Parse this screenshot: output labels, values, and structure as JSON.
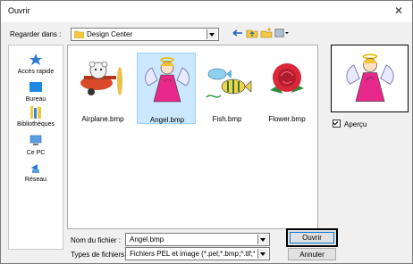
{
  "dialog": {
    "title": "Ouvrir",
    "close_glyph": "✕"
  },
  "lookin": {
    "label": "Regarder dans :",
    "value": "Design Center",
    "toolbar_icons": [
      "back-icon",
      "up-folder-icon",
      "new-folder-icon",
      "view-menu-icon"
    ]
  },
  "places": [
    {
      "label": "Accès rapide",
      "icon": "star-icon"
    },
    {
      "label": "Bureau",
      "icon": "desktop-icon"
    },
    {
      "label": "Bibliothèques",
      "icon": "libraries-icon"
    },
    {
      "label": "Ce PC",
      "icon": "computer-icon"
    },
    {
      "label": "Réseau",
      "icon": "network-icon"
    }
  ],
  "files": [
    {
      "name": "Airplane.bmp",
      "icon": "airplane-thumbnail",
      "selected": false
    },
    {
      "name": "Angel.bmp",
      "icon": "angel-thumbnail",
      "selected": true
    },
    {
      "name": "Fish.bmp",
      "icon": "fish-thumbnail",
      "selected": false
    },
    {
      "name": "Flower.bmp",
      "icon": "flower-thumbnail",
      "selected": false
    }
  ],
  "preview": {
    "checkbox_label": "Aperçu",
    "checked": true
  },
  "filename": {
    "label": "Nom du fichier :",
    "value": "Angel.bmp"
  },
  "filetype": {
    "label": "Types de fichiers :",
    "value": "Fichiers PEL et image (*.pel;*.bmp;*.tif;*.jpg;*.wr"
  },
  "buttons": {
    "open": "Ouvrir",
    "cancel": "Annuler"
  },
  "colors": {
    "selection": "#cce8ff",
    "angel_pink": "#e8298b",
    "folder_yellow": "#f5c842"
  }
}
